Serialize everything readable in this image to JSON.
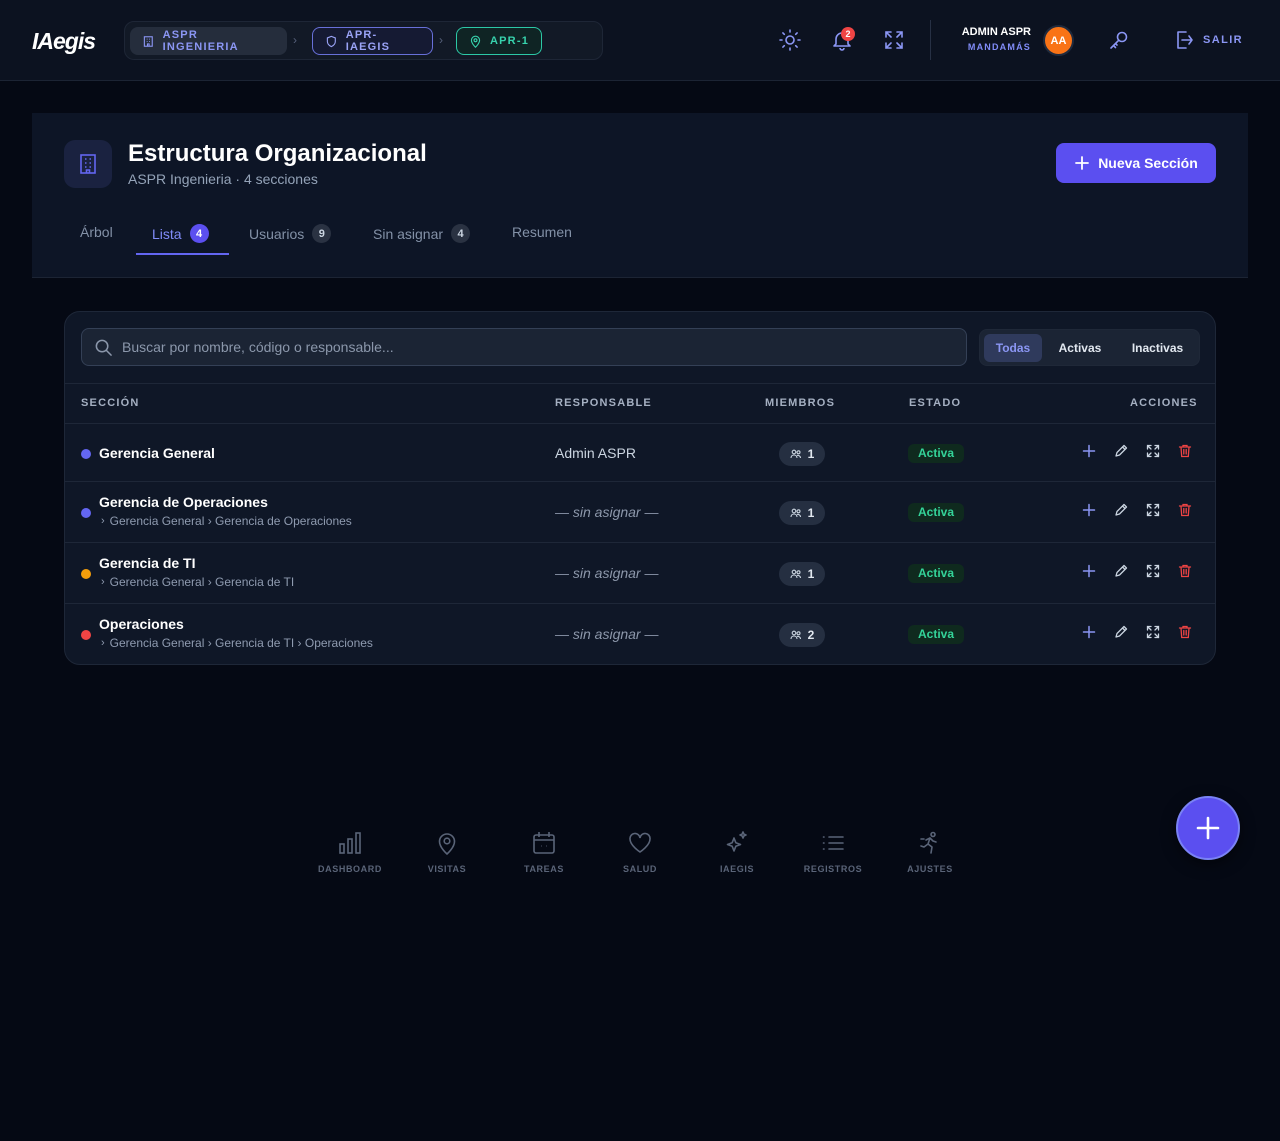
{
  "app": {
    "logo": "IAegis"
  },
  "breadcrumb": [
    {
      "label": "ASPR INGENIERIA",
      "icon": "building-icon"
    },
    {
      "label": "APR-IAEGIS",
      "icon": "shield-icon"
    },
    {
      "label": "APR-1",
      "icon": "map-pin-icon"
    }
  ],
  "topbar": {
    "notifications_count": "2",
    "user_name": "ADMIN ASPR",
    "user_role": "MANDAMÁS",
    "avatar_initials": "AA",
    "logout_label": "SALIR"
  },
  "page": {
    "title": "Estructura Organizacional",
    "subtitle": "ASPR Ingenieria · 4 secciones",
    "new_button": "Nueva Sección",
    "tabs": [
      {
        "label": "Árbol",
        "count": null
      },
      {
        "label": "Lista",
        "count": "4",
        "active": true
      },
      {
        "label": "Usuarios",
        "count": "9"
      },
      {
        "label": "Sin asignar",
        "count": "4"
      },
      {
        "label": "Resumen",
        "count": null
      }
    ]
  },
  "table": {
    "search_placeholder": "Buscar por nombre, código o responsable...",
    "search_value": "",
    "filters": [
      "Todas",
      "Activas",
      "Inactivas"
    ],
    "active_filter": "Todas",
    "headers": [
      "SECCIÓN",
      "RESPONSABLE",
      "MIEMBROS",
      "ESTADO",
      "ACCIONES"
    ],
    "rows": [
      {
        "name": "Gerencia General",
        "path": "",
        "color": "#6366f1",
        "responsable": "Admin ASPR",
        "members": "1",
        "estado": "Activa"
      },
      {
        "name": "Gerencia de Operaciones",
        "path": "Gerencia General › Gerencia de Operaciones",
        "color": "#6366f1",
        "responsable": "— sin asignar —",
        "members": "1",
        "estado": "Activa"
      },
      {
        "name": "Gerencia de TI",
        "path": "Gerencia General › Gerencia de TI",
        "color": "#f59e0b",
        "responsable": "— sin asignar —",
        "members": "1",
        "estado": "Activa"
      },
      {
        "name": "Operaciones",
        "path": "Gerencia General › Gerencia de TI › Operaciones",
        "color": "#ef4444",
        "responsable": "— sin asignar —",
        "members": "2",
        "estado": "Activa"
      }
    ]
  },
  "bottom_nav": [
    {
      "label": "DASHBOARD",
      "icon": "bar-chart-icon"
    },
    {
      "label": "VISITAS",
      "icon": "map-pin-icon"
    },
    {
      "label": "TAREAS",
      "icon": "calendar-icon"
    },
    {
      "label": "SALUD",
      "icon": "heart-icon"
    },
    {
      "label": "IAEGIS",
      "icon": "sparkles-icon"
    },
    {
      "label": "REGISTROS",
      "icon": "list-icon"
    },
    {
      "label": "AJUSTES",
      "icon": "runner-icon"
    }
  ],
  "colors": {
    "accent": "#5b4ff0",
    "success": "#34d399",
    "danger": "#ef4444",
    "background": "#050914"
  }
}
